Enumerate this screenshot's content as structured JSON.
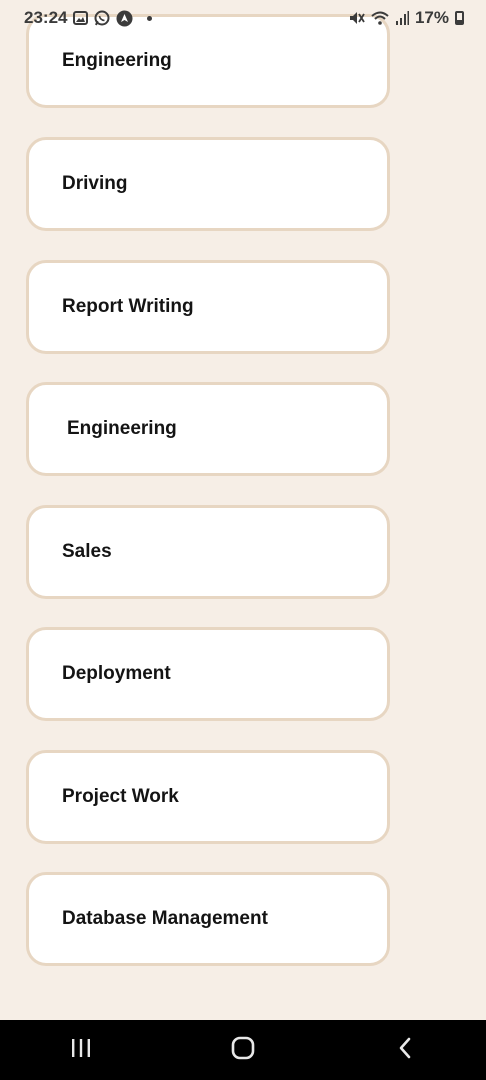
{
  "status_bar": {
    "time": "23:24",
    "battery": "17%",
    "left_icons": [
      "gallery-icon",
      "whatsapp-icon",
      "navigation-icon"
    ],
    "right_icons": [
      "mute-icon",
      "wifi-icon",
      "signal-icon",
      "battery-icon"
    ]
  },
  "list": {
    "items": [
      {
        "label": "Engineering"
      },
      {
        "label": "Driving"
      },
      {
        "label": "Report Writing"
      },
      {
        "label": "Engineering"
      },
      {
        "label": "Sales"
      },
      {
        "label": "Deployment"
      },
      {
        "label": "Project Work"
      },
      {
        "label": "Database Management"
      }
    ]
  },
  "nav_bar": {
    "buttons": [
      "recent-apps-icon",
      "home-icon",
      "back-icon"
    ]
  },
  "colors": {
    "background": "#f6eee6",
    "card_border": "#e7d6c2",
    "card_fill": "#ffffff",
    "nav_bar": "#000000"
  }
}
